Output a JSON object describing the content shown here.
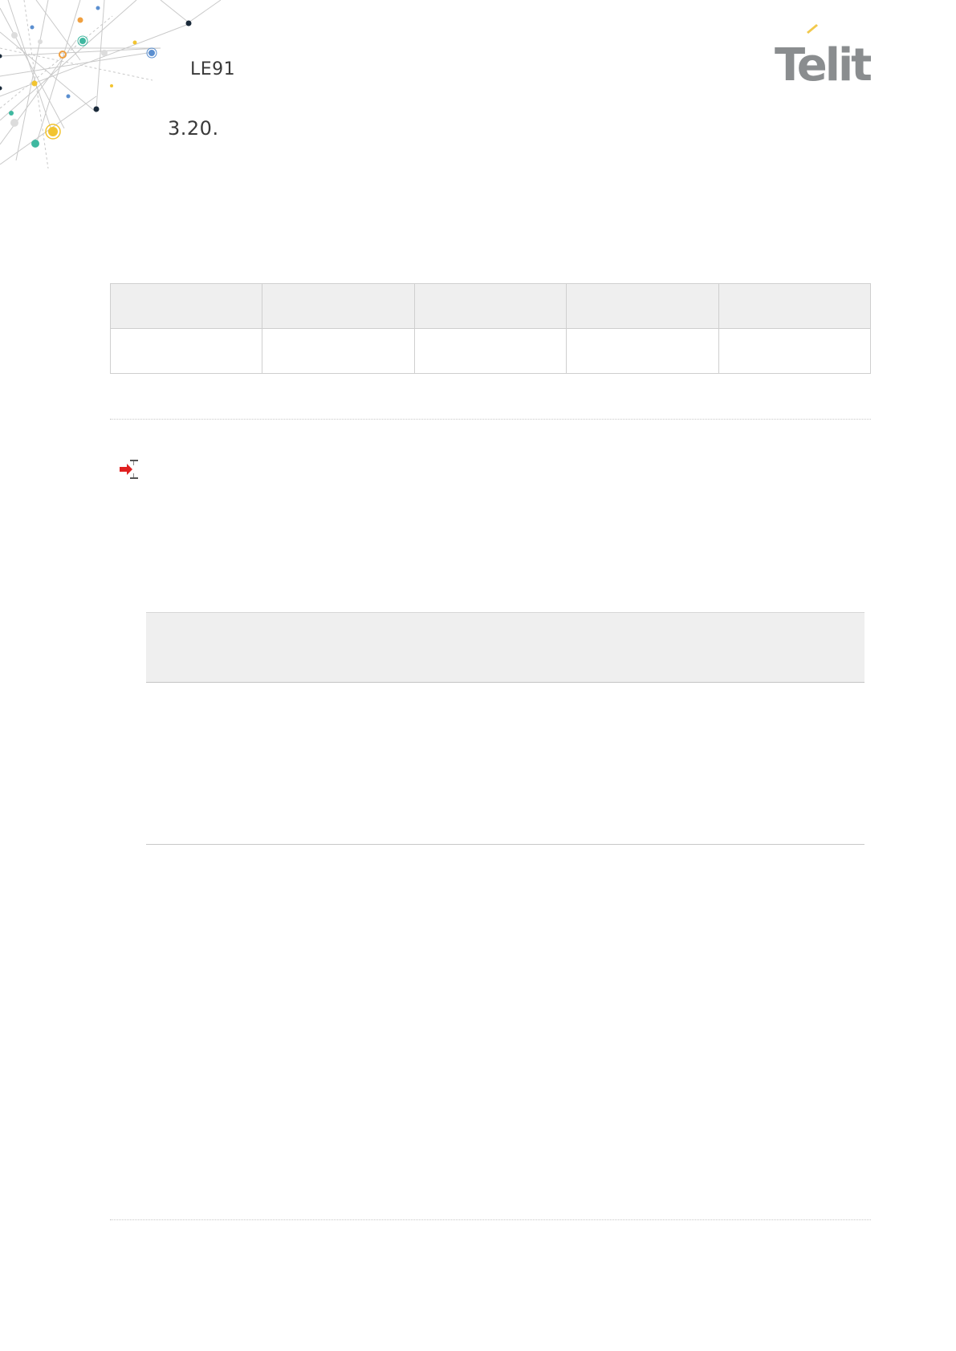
{
  "header": {
    "doc_title": "LE91",
    "section_number": "3.20.",
    "logo_text": "Telit"
  },
  "icons": {
    "corner_art": "network-nodes-decoration",
    "command_arrow": "arrow-right-icon"
  },
  "colors": {
    "logo_gray": "#8a8d8f",
    "logo_accent": "#f2c94c",
    "table_header_bg": "#efefef",
    "arrow_red": "#e02020"
  }
}
